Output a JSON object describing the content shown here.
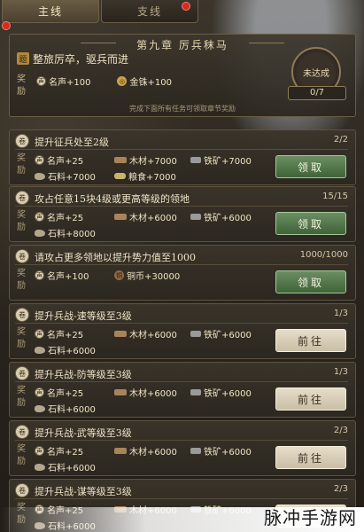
{
  "tabs": [
    {
      "label": "主线",
      "active": true
    },
    {
      "label": "支线",
      "active": false
    }
  ],
  "chapter": {
    "title": "第九章  厉兵秣马",
    "goal_icon": "题",
    "goal": "整旅厉卒，驱兵而进",
    "reward_label": "奖励",
    "rewards": [
      {
        "icon": "fame-icon",
        "text": "名声+100"
      },
      {
        "icon": "gold-icon",
        "text": "金铢+100"
      }
    ],
    "status": "未达成",
    "progress": "0/7",
    "hint": "完成下面所有任务可领取章节奖励"
  },
  "tasks": [
    {
      "title": "提升征兵处至2级",
      "count": "2/2",
      "button": "领取",
      "button_type": "claim",
      "rewards": [
        {
          "icon": "fame",
          "text": "名声+25"
        },
        {
          "icon": "wood",
          "text": "木材+7000"
        },
        {
          "icon": "iron",
          "text": "铁矿+7000"
        },
        {
          "icon": "stone",
          "text": "石料+7000"
        },
        {
          "icon": "grain",
          "text": "粮食+7000"
        }
      ]
    },
    {
      "title": "攻占任意15块4级或更高等级的领地",
      "count": "15/15",
      "button": "领取",
      "button_type": "claim",
      "rewards": [
        {
          "icon": "fame",
          "text": "名声+25"
        },
        {
          "icon": "wood",
          "text": "木材+6000"
        },
        {
          "icon": "iron",
          "text": "铁矿+6000"
        },
        {
          "icon": "stone",
          "text": "石料+8000"
        }
      ]
    },
    {
      "title": "请攻占更多领地以提升势力值至1000",
      "count": "1000/1000",
      "button": "领取",
      "button_type": "claim",
      "rewards": [
        {
          "icon": "fame",
          "text": "名声+100"
        },
        {
          "icon": "coin",
          "text": "铜币+30000"
        }
      ]
    },
    {
      "title": "提升兵战-速等级至3级",
      "count": "1/3",
      "button": "前往",
      "button_type": "goto",
      "rewards": [
        {
          "icon": "fame",
          "text": "名声+25"
        },
        {
          "icon": "wood",
          "text": "木材+6000"
        },
        {
          "icon": "iron",
          "text": "铁矿+6000"
        },
        {
          "icon": "stone",
          "text": "石料+6000"
        }
      ]
    },
    {
      "title": "提升兵战-防等级至3级",
      "count": "1/3",
      "button": "前往",
      "button_type": "goto",
      "rewards": [
        {
          "icon": "fame",
          "text": "名声+25"
        },
        {
          "icon": "wood",
          "text": "木材+6000"
        },
        {
          "icon": "iron",
          "text": "铁矿+6000"
        },
        {
          "icon": "stone",
          "text": "石料+6000"
        }
      ]
    },
    {
      "title": "提升兵战-武等级至3级",
      "count": "2/3",
      "button": "前往",
      "button_type": "goto",
      "rewards": [
        {
          "icon": "fame",
          "text": "名声+25"
        },
        {
          "icon": "wood",
          "text": "木材+6000"
        },
        {
          "icon": "iron",
          "text": "铁矿+6000"
        },
        {
          "icon": "stone",
          "text": "石料+6000"
        }
      ]
    },
    {
      "title": "提升兵战-谋等级至3级",
      "count": "2/3",
      "button": "前往",
      "button_type": "goto",
      "rewards": [
        {
          "icon": "fame",
          "text": "名声+25"
        },
        {
          "icon": "wood",
          "text": "木材+6000"
        },
        {
          "icon": "iron",
          "text": "铁矿+6000"
        },
        {
          "icon": "stone",
          "text": "石料+6000"
        }
      ]
    }
  ],
  "task_reward_label": "奖励",
  "watermark": "脉冲手游网",
  "colors": {
    "claim_button": "#4f7646",
    "goto_button": "#d8cfb8",
    "notification_dot": "#d32b1c"
  }
}
